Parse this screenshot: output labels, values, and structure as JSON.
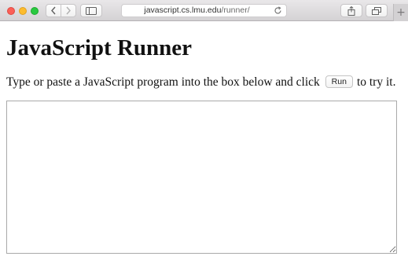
{
  "browser": {
    "url_host": "javascript.cs.lmu.edu",
    "url_path": "/runner/",
    "new_tab_label": "+"
  },
  "page": {
    "title": "JavaScript Runner",
    "instructions_before": "Type or paste a JavaScript program into the box below and click",
    "run_button_label": "Run",
    "instructions_after": "to try it.",
    "editor_value": ""
  }
}
